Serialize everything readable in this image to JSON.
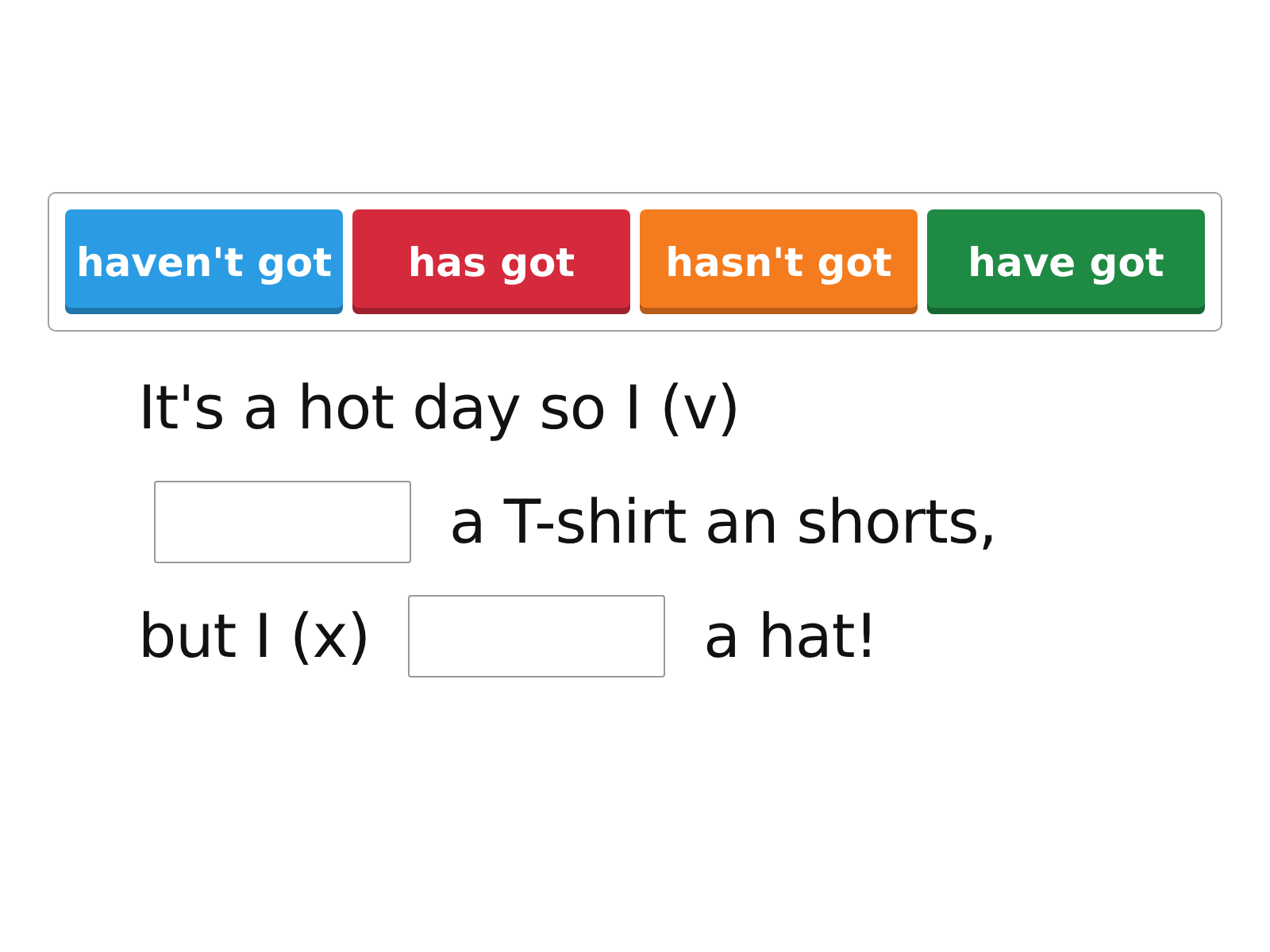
{
  "word_bank": [
    {
      "label": "haven't got",
      "color": "#2b9ce3"
    },
    {
      "label": "has got",
      "color": "#d42a3c"
    },
    {
      "label": "hasn't got",
      "color": "#f47b1e"
    },
    {
      "label": "have got",
      "color": "#1f8a43"
    }
  ],
  "sentence_lines": [
    [
      {
        "kind": "text",
        "text": "It's a hot day so I (v)"
      }
    ],
    [
      {
        "kind": "blank"
      },
      {
        "kind": "text",
        "text": "a T-shirt an shorts,"
      }
    ],
    [
      {
        "kind": "text",
        "text": "but I (x)"
      },
      {
        "kind": "blank"
      },
      {
        "kind": "text",
        "text": "a hat!"
      }
    ]
  ]
}
